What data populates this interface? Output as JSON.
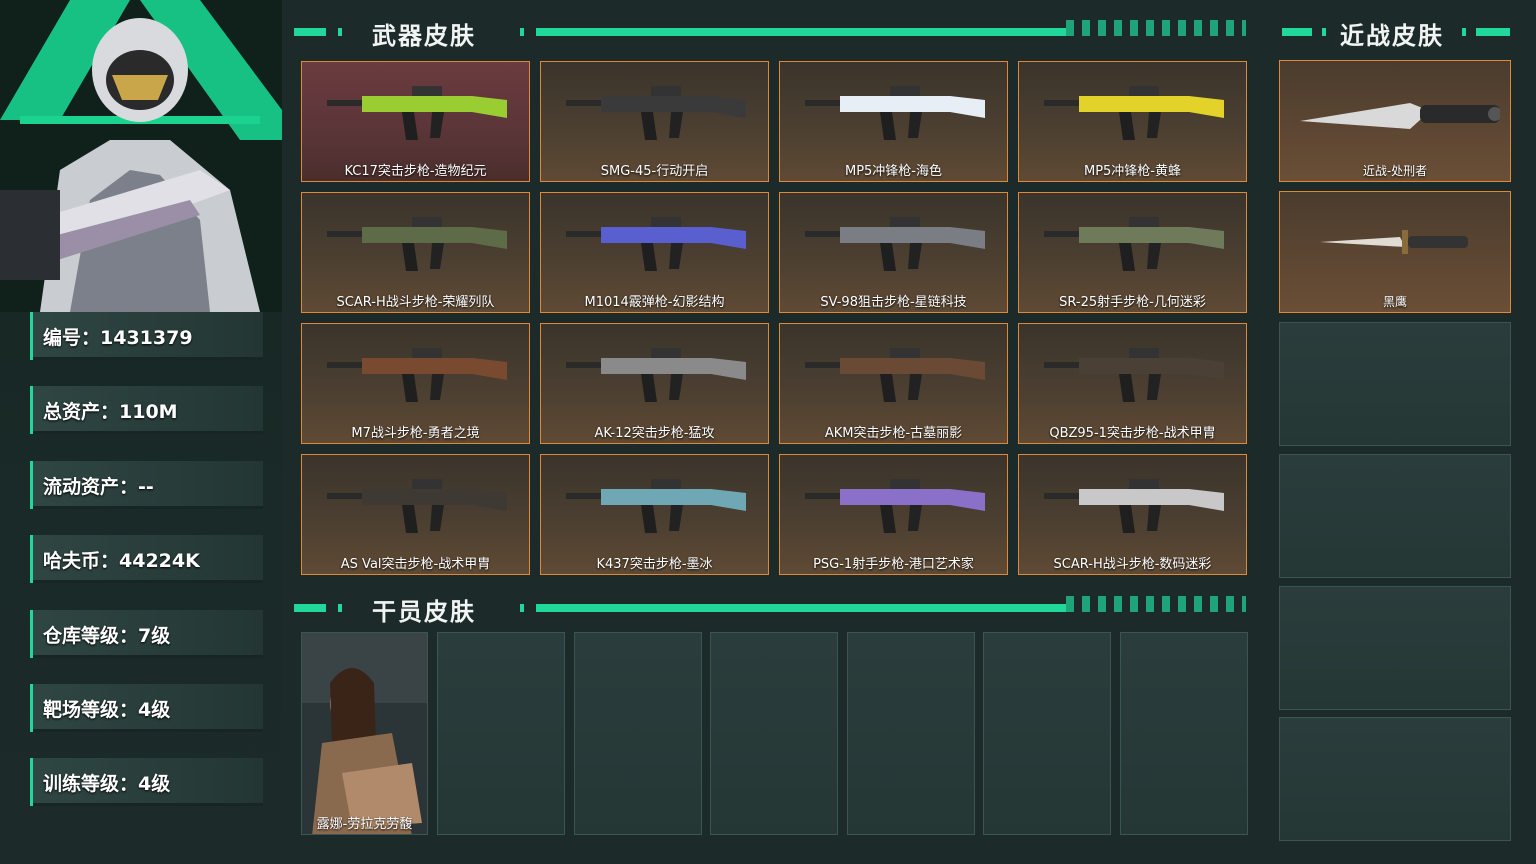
{
  "player": {
    "stats": [
      {
        "label": "编号：1431379"
      },
      {
        "label": "总资产：110M"
      },
      {
        "label": "流动资产：--"
      },
      {
        "label": "哈夫币：44224K"
      },
      {
        "label": "仓库等级：7级"
      },
      {
        "label": "靶场等级：4级"
      },
      {
        "label": "训练等级：4级"
      }
    ]
  },
  "sections": {
    "weapons_title": "武器皮肤",
    "melee_title": "近战皮肤",
    "operators_title": "干员皮肤"
  },
  "weapons": [
    {
      "name": "KC17突击步枪-造物纪元",
      "color": "#9acd32"
    },
    {
      "name": "SMG-45-行动开启",
      "color": "#3a3a3a"
    },
    {
      "name": "MP5冲锋枪-海色",
      "color": "#e8eef6"
    },
    {
      "name": "MP5冲锋枪-黄蜂",
      "color": "#e3d22a"
    },
    {
      "name": "SCAR-H战斗步枪-荣耀列队",
      "color": "#5e6b48"
    },
    {
      "name": "M1014霰弹枪-幻影结构",
      "color": "#5a5fd0"
    },
    {
      "name": "SV-98狙击步枪-星链科技",
      "color": "#7a7d84"
    },
    {
      "name": "SR-25射手步枪-几何迷彩",
      "color": "#6e7a5a"
    },
    {
      "name": "M7战斗步枪-勇者之境",
      "color": "#7a4a30"
    },
    {
      "name": "AK-12突击步枪-猛攻",
      "color": "#8a8a8a"
    },
    {
      "name": "AKM突击步枪-古墓丽影",
      "color": "#6a4a35"
    },
    {
      "name": "QBZ95-1突击步枪-战术甲胄",
      "color": "#4a4035"
    },
    {
      "name": "AS Val突击步枪-战术甲胄",
      "color": "#3e3a33"
    },
    {
      "name": "K437突击步枪-墨冰",
      "color": "#6fa8b4"
    },
    {
      "name": "PSG-1射手步枪-港口艺术家",
      "color": "#8a70c8"
    },
    {
      "name": "SCAR-H战斗步枪-数码迷彩",
      "color": "#c8c8c8"
    }
  ],
  "melee": [
    {
      "name": "近战-处刑者"
    },
    {
      "name": "黑鹰"
    }
  ],
  "operators": [
    {
      "name": "露娜-劳拉克劳馥"
    }
  ]
}
